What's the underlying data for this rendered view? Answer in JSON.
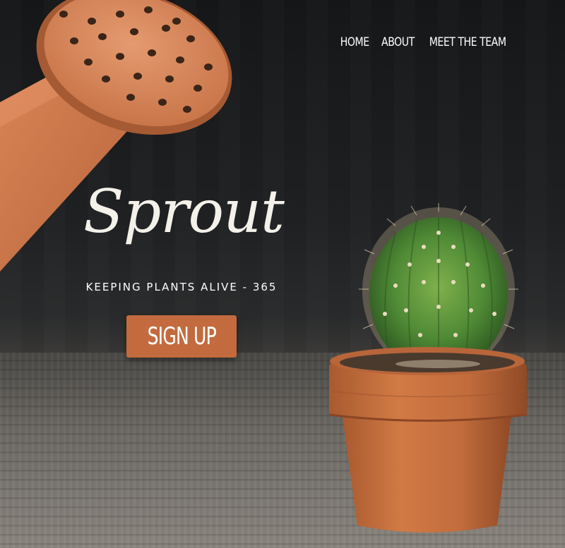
{
  "nav": {
    "items": [
      {
        "label": "HOME"
      },
      {
        "label": "ABOUT"
      },
      {
        "label": "MEET THE TEAM"
      }
    ]
  },
  "hero": {
    "logo_text": "Sprout",
    "tagline": "KEEPING PLANTS ALIVE - 365",
    "cta_label": "SIGN UP"
  },
  "colors": {
    "accent": "#c36b3e",
    "background": "#1e1f21",
    "text": "#ffffff"
  },
  "imagery": {
    "background_photo": "cactus-in-terracotta-pot",
    "watering_can": "watering-can-spout"
  }
}
